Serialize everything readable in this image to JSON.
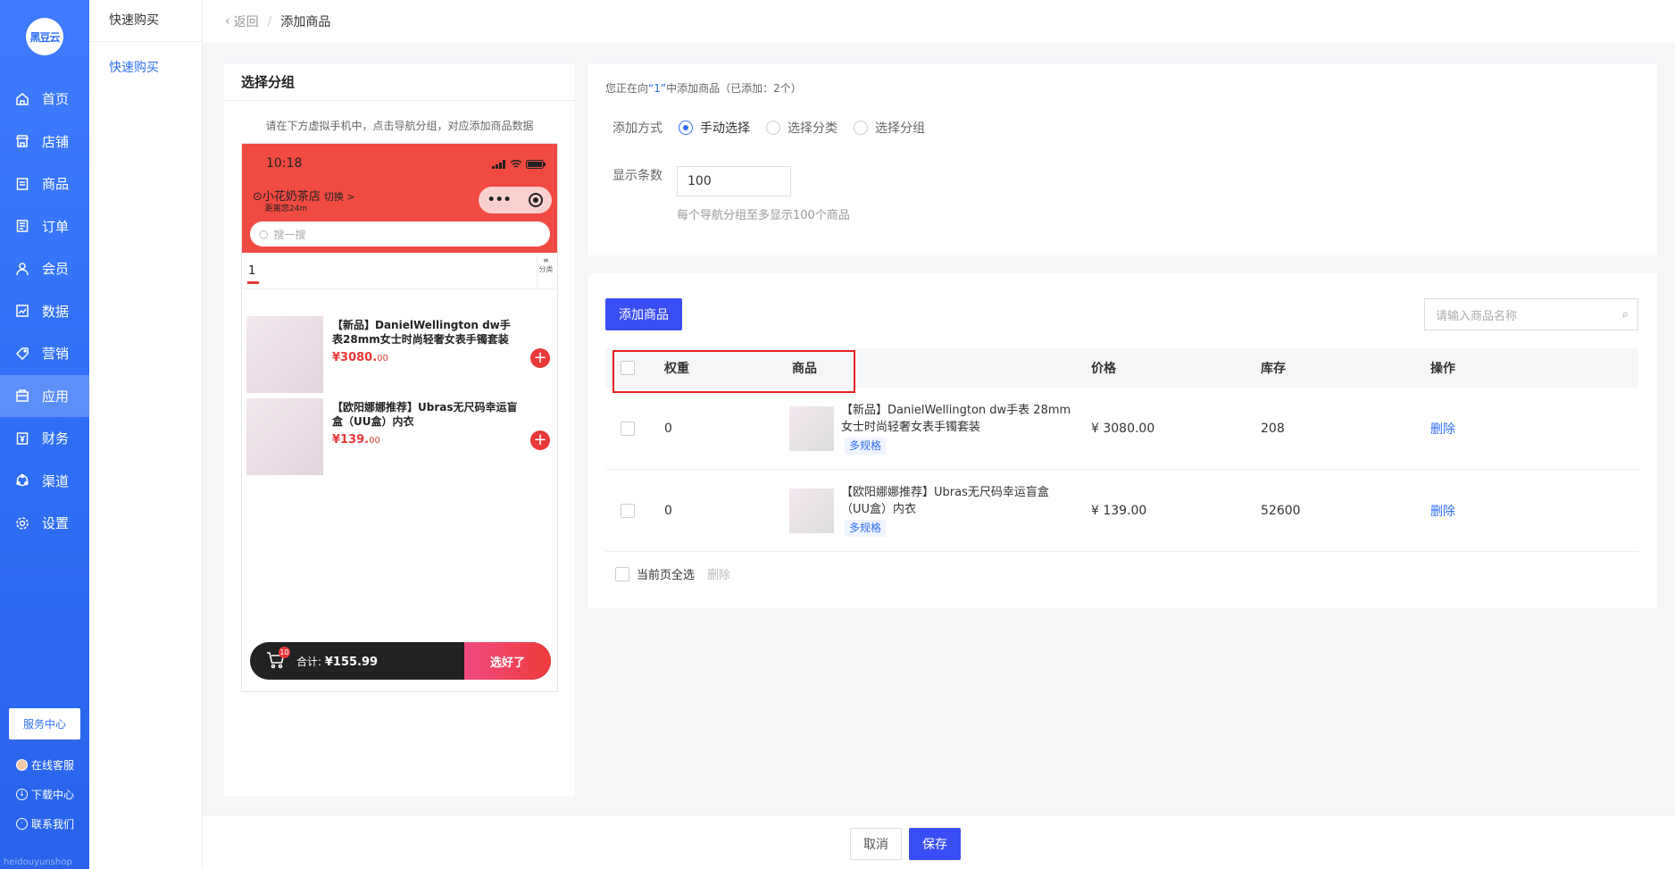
{
  "logo": {
    "text": "黑豆云"
  },
  "nav": [
    {
      "label": "首页",
      "icon": "home-icon"
    },
    {
      "label": "店铺",
      "icon": "store-icon"
    },
    {
      "label": "商品",
      "icon": "goods-icon"
    },
    {
      "label": "订单",
      "icon": "order-icon"
    },
    {
      "label": "会员",
      "icon": "member-icon"
    },
    {
      "label": "数据",
      "icon": "data-icon"
    },
    {
      "label": "营销",
      "icon": "marketing-icon"
    },
    {
      "label": "应用",
      "icon": "app-icon",
      "active": true
    },
    {
      "label": "财务",
      "icon": "finance-icon"
    },
    {
      "label": "渠道",
      "icon": "channel-icon"
    },
    {
      "label": "设置",
      "icon": "settings-icon"
    }
  ],
  "service_center": "服务中心",
  "side_links": {
    "online": "在线客服",
    "download": "下载中心",
    "contact": "联系我们"
  },
  "side_footer": "heidouyunshop",
  "subside": {
    "title": "快速购买",
    "link": "快速购买"
  },
  "breadcrumb": {
    "back": "返回",
    "sep": "/",
    "current": "添加商品"
  },
  "left_panel": {
    "title": "选择分组",
    "hint": "请在下方虚拟手机中，点击导航分组，对应添加商品数据",
    "phone": {
      "time": "10:18",
      "store": "小花奶茶店",
      "switch": "切换 >",
      "distance": "距离您24m",
      "search_placeholder": "搜一搜",
      "tab": "1",
      "tab_more": "分类",
      "products": [
        {
          "name": "【新品】DanielWellington dw手表28mm女士时尚轻奢女表手镯套装",
          "price_int": "¥3080.",
          "price_dec": "00"
        },
        {
          "name": "【欧阳娜娜推荐】Ubras无尺码幸运盲盒（UU盒）内衣",
          "price_int": "¥139.",
          "price_dec": "00"
        }
      ],
      "cart_count": "10",
      "cart_total_label": "合计:",
      "cart_total": "¥155.99",
      "cart_button": "选好了"
    }
  },
  "config": {
    "note_prefix": "您正在向",
    "note_group": "“1”",
    "note_suffix": "中添加商品（已添加：2个）",
    "method_label": "添加方式",
    "methods": [
      {
        "label": "手动选择",
        "selected": true
      },
      {
        "label": "选择分类",
        "selected": false
      },
      {
        "label": "选择分组",
        "selected": false
      }
    ],
    "count_label": "显示条数",
    "count_value": "100",
    "count_help": "每个导航分组至多显示100个商品"
  },
  "table": {
    "add_button": "添加商品",
    "search_placeholder": "请输入商品名称",
    "columns": {
      "weight": "权重",
      "product": "商品",
      "price": "价格",
      "stock": "库存",
      "action": "操作"
    },
    "rows": [
      {
        "weight": "0",
        "name": "【新品】DanielWellington dw手表 28mm女士时尚轻奢女表手镯套装",
        "tag": "多规格",
        "price": "¥ 3080.00",
        "stock": "208",
        "action": "删除"
      },
      {
        "weight": "0",
        "name": "【欧阳娜娜推荐】Ubras无尺码幸运盲盒（UU盒）内衣",
        "tag": "多规格",
        "price": "¥ 139.00",
        "stock": "52600",
        "action": "删除"
      }
    ],
    "select_all": "当前页全选",
    "bulk_delete": "删除"
  },
  "footer": {
    "cancel": "取消",
    "save": "保存"
  }
}
